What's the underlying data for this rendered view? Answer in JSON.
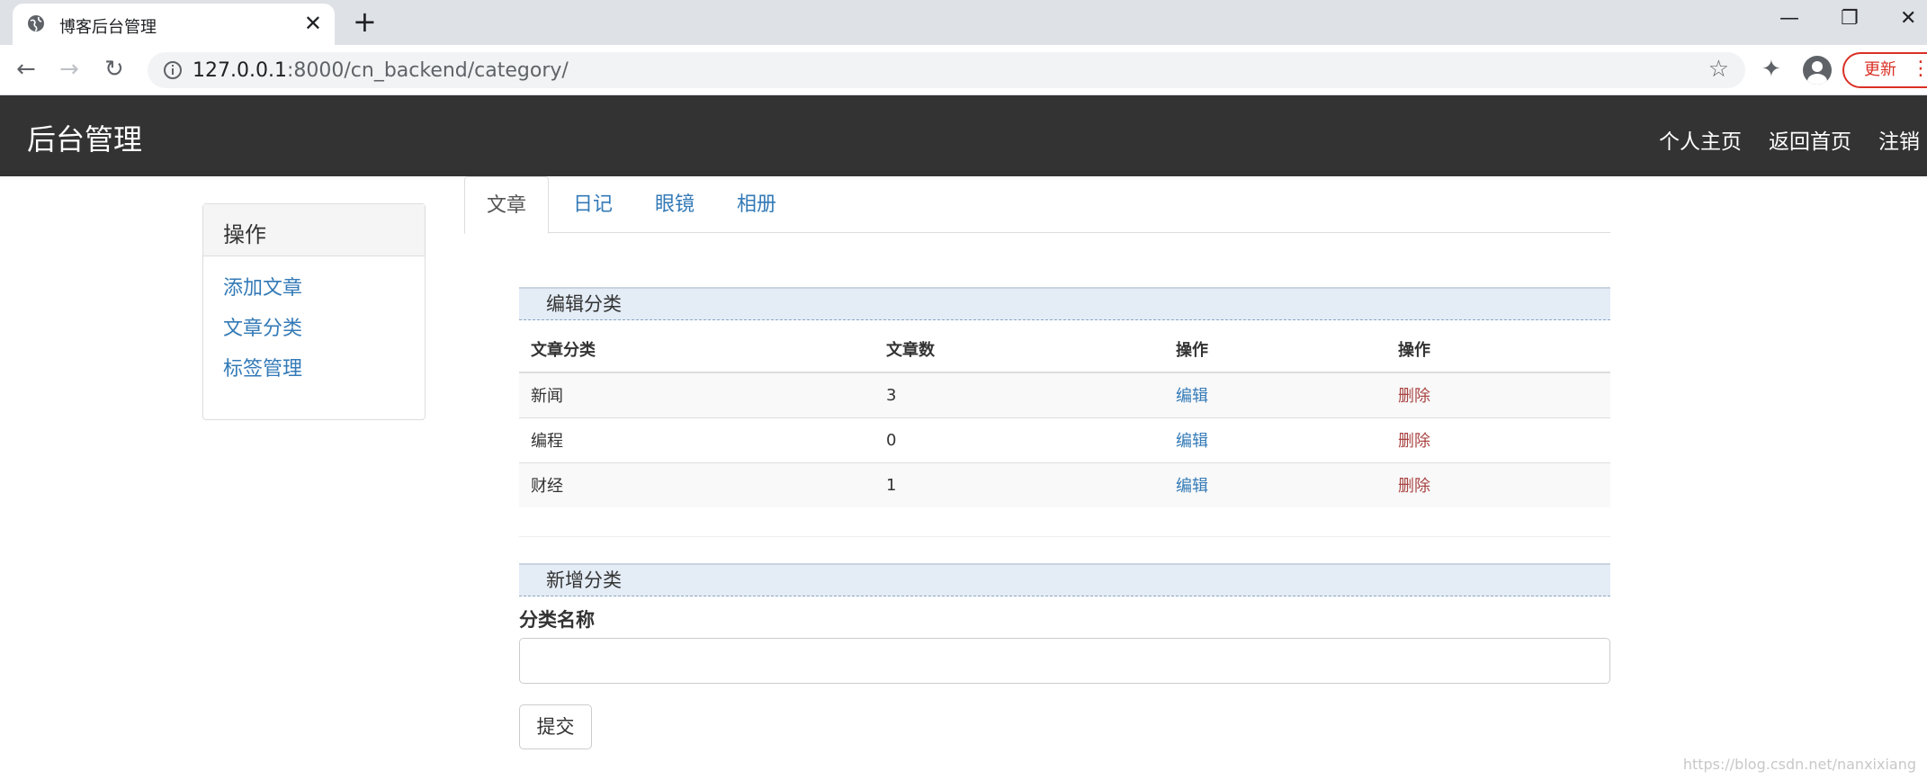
{
  "browser": {
    "tab_title": "博客后台管理",
    "tab_close": "✕",
    "new_tab": "+",
    "url_host": "127.0.0.1",
    "url_rest": ":8000/cn_backend/category/",
    "update_label": "更新",
    "minimize": "—",
    "restore": "❐",
    "close": "✕"
  },
  "navbar": {
    "brand": "后台管理",
    "links": [
      "个人主页",
      "返回首页",
      "注销"
    ]
  },
  "sidebar": {
    "heading": "操作",
    "links": [
      "添加文章",
      "文章分类",
      "标签管理"
    ]
  },
  "tabs": [
    "文章",
    "日记",
    "眼镜",
    "相册"
  ],
  "edit_section": {
    "title": "编辑分类",
    "columns": [
      "文章分类",
      "文章数",
      "操作",
      "操作"
    ],
    "rows": [
      {
        "name": "新闻",
        "count": "3",
        "edit": "编辑",
        "delete": "删除"
      },
      {
        "name": "编程",
        "count": "0",
        "edit": "编辑",
        "delete": "删除"
      },
      {
        "name": "财经",
        "count": "1",
        "edit": "编辑",
        "delete": "删除"
      }
    ]
  },
  "add_section": {
    "title": "新增分类",
    "label": "分类名称",
    "input_value": "",
    "submit": "提交"
  },
  "watermark": "https://blog.csdn.net/nanxixiang",
  "colors": {
    "navbar_bg": "#333333",
    "link": "#337ab7",
    "danger": "#a94442",
    "section_bg": "#e4ecf6"
  }
}
